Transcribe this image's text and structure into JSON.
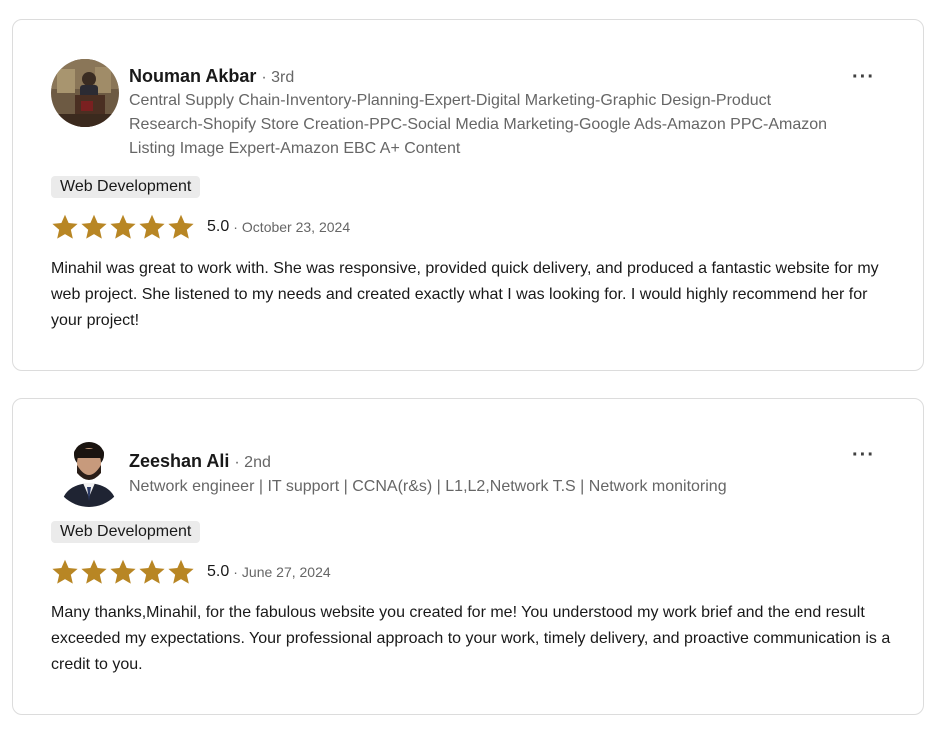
{
  "reviews": [
    {
      "name": "Nouman Akbar",
      "degree": "· 3rd",
      "headline": "Central Supply Chain-Inventory-Planning-Expert-Digital Marketing-Graphic Design-Product Research-Shopify Store Creation-PPC-Social Media Marketing-Google Ads-Amazon PPC-Amazon Listing Image Expert-Amazon EBC A+ Content",
      "more_label": "···",
      "tag": "Web Development",
      "stars": 5,
      "score": "5.0",
      "separator": "·",
      "date": "October 23, 2024",
      "text": "Minahil was great to work with. She was responsive, provided quick delivery, and produced a fantastic website for my web project. She listened to my needs and created exactly what I was looking for. I would highly recommend her for your project!"
    },
    {
      "name": "Zeeshan Ali",
      "degree": "· 2nd",
      "headline": "Network engineer | IT support | CCNA(r&s) | L1,L2,Network T.S | Network monitoring",
      "more_label": "···",
      "tag": "Web Development",
      "stars": 5,
      "score": "5.0",
      "separator": "·",
      "date": "June 27, 2024",
      "text": "Many thanks,Minahil, for the fabulous website you created for me! You understood my work brief and the end result exceeded my expectations. Your professional approach to your work, timely delivery, and proactive communication is a credit to you."
    }
  ],
  "colors": {
    "star": "#b88624",
    "tag_bg": "#ebebeb",
    "muted_text": "#666666",
    "text": "#191919",
    "border": "#dcdcdc"
  },
  "icons": {
    "more": "more-horizontal-icon",
    "star": "star-icon",
    "avatar": "profile-photo"
  }
}
